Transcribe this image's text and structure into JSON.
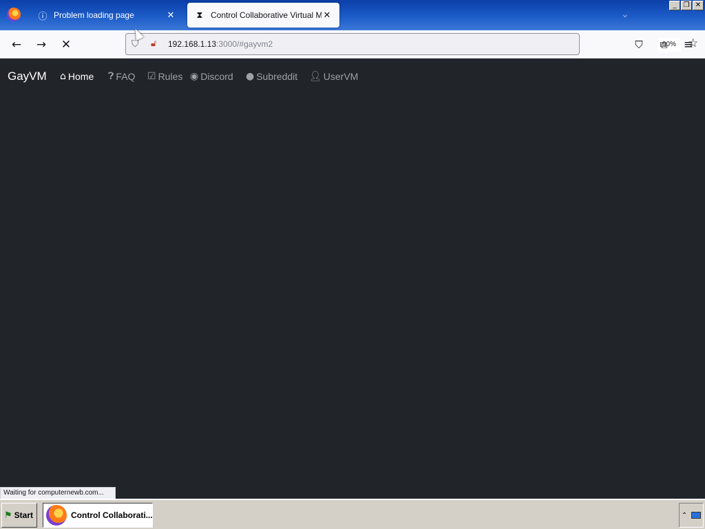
{
  "browser": {
    "tabs": [
      {
        "label": "Problem loading page",
        "icon": "info-icon",
        "active": false
      },
      {
        "label": "Control Collaborative Virtual Machine",
        "icon": "hourglass-icon",
        "active": true
      }
    ],
    "nav": {
      "back_icon": "back-arrow-icon",
      "forward_icon": "forward-arrow-icon",
      "stop_icon": "stop-icon"
    },
    "url": {
      "host": "192.168.1.13",
      "rest": ":3000/#gayvm2"
    },
    "zoom": "90%",
    "toolbar_icons": [
      "pocket-icon",
      "extensions-icon",
      "menu-icon"
    ]
  },
  "site": {
    "brand": "GayVM",
    "links": [
      {
        "label": "Home",
        "icon": "home-icon",
        "active": true
      },
      {
        "label": "FAQ",
        "icon": "question-icon",
        "active": false
      },
      {
        "label": "Rules",
        "icon": "clipboard-icon",
        "active": false
      },
      {
        "label": "Discord",
        "icon": "discord-icon",
        "active": false
      },
      {
        "label": "Subreddit",
        "icon": "reddit-icon",
        "active": false
      },
      {
        "label": "UserVM",
        "icon": "user-icon",
        "active": false
      }
    ]
  },
  "status_text": "Waiting for computernewb.com...",
  "taskbar": {
    "start_label": "Start",
    "task_label": "Control Collaborati..."
  },
  "colors": {
    "page_bg": "#212529",
    "tab_strip": "#1d5cc8",
    "nav_active": "#ffffff",
    "nav_inactive": "#9ea2a7"
  }
}
